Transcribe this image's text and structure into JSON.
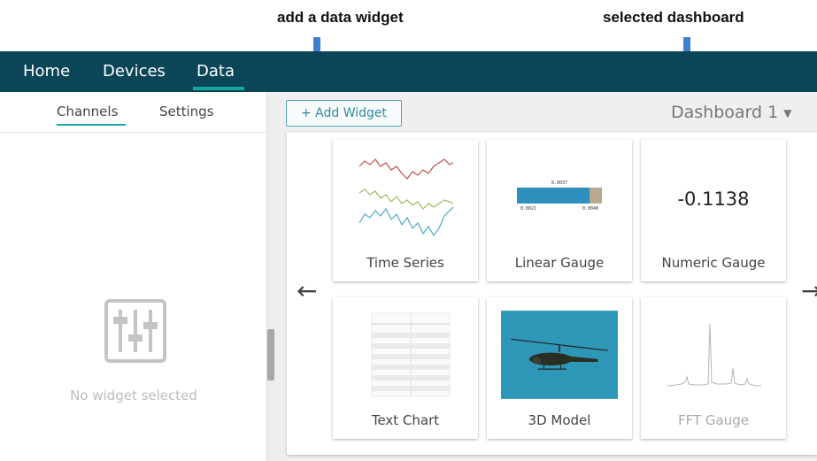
{
  "annotations": {
    "add_widget": "add a data widget",
    "selected_dashboard": "selected dashboard"
  },
  "nav": {
    "items": [
      {
        "label": "Home"
      },
      {
        "label": "Devices"
      },
      {
        "label": "Data",
        "active": true
      }
    ]
  },
  "left_panel": {
    "tabs": [
      {
        "label": "Channels",
        "active": true
      },
      {
        "label": "Settings"
      }
    ],
    "empty_message": "No widget selected",
    "empty_icon": "sliders-icon"
  },
  "toolbar": {
    "add_widget_label": "+ Add Widget",
    "dashboard_name": "Dashboard 1",
    "dropdown_icon": "caret-down-icon"
  },
  "carousel": {
    "prev_icon": "arrow-left-icon",
    "next_icon": "arrow-right-icon",
    "widgets": [
      {
        "label": "Time Series"
      },
      {
        "label": "Linear Gauge",
        "preview": {
          "top_value": "0.0037",
          "min": "0.0021",
          "max": "0.0040"
        }
      },
      {
        "label": "Numeric Gauge",
        "preview": {
          "value": "-0.1138"
        }
      },
      {
        "label": "Text Chart"
      },
      {
        "label": "3D Model"
      },
      {
        "label": "FFT Gauge",
        "disabled": true
      }
    ]
  },
  "colors": {
    "navbar": "#0b4658",
    "accent": "#1aa6a0",
    "button_border": "#55a7b7"
  }
}
